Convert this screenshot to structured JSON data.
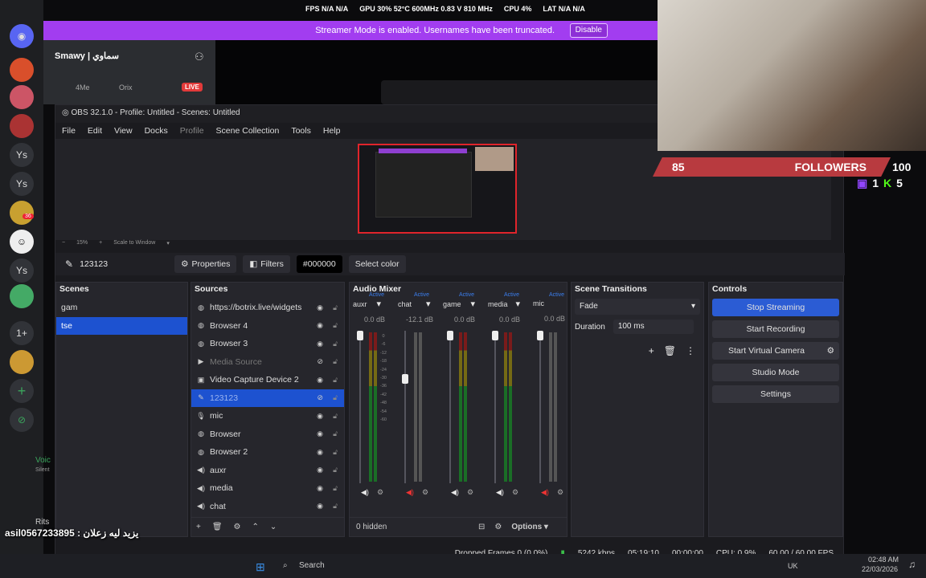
{
  "stats_overlay": {
    "fps_label": "FPS",
    "fps_value": "N/A N/A",
    "gpu": "GPU 30% 52°C 600MHz 0.83 V 810 MHz",
    "cpu": "CPU 4%",
    "lat": "LAT N/A N/A"
  },
  "banner": {
    "text": "Streamer Mode is enabled. Usernames have been truncated.",
    "button": "Disable"
  },
  "discord": {
    "server_title": "Smawy | سماوي",
    "voice_user": "4Me",
    "voice_tag": "Orix",
    "live_badge": "LIVE",
    "rail_items": [
      "Ys",
      "Ys",
      "Ys",
      "1+"
    ],
    "badge_36": "36",
    "voice_label": "Voic",
    "voice_sub": "Silent",
    "bottom_user": "Rits"
  },
  "obs": {
    "title": "OBS 32.1.0 - Profile: Untitled - Scenes: Untitled",
    "menu": [
      "File",
      "Edit",
      "View",
      "Docks",
      "Profile",
      "Scene Collection",
      "Tools",
      "Help"
    ],
    "zoom": {
      "pct": "15%",
      "scale": "Scale to Window"
    },
    "toolbar": {
      "source_name": "123123",
      "properties": "Properties",
      "filters": "Filters",
      "color_hex": "#000000",
      "select_color": "Select color"
    },
    "scenes": {
      "title": "Scenes",
      "items": [
        "gam",
        "tse"
      ]
    },
    "sources": {
      "title": "Sources",
      "items": [
        {
          "name": "https://botrix.live/widgets"
        },
        {
          "name": "Browser 4"
        },
        {
          "name": "Browser 3"
        },
        {
          "name": "Media Source"
        },
        {
          "name": "Video Capture Device 2"
        },
        {
          "name": "123123"
        },
        {
          "name": "mic"
        },
        {
          "name": "Browser"
        },
        {
          "name": "Browser 2"
        },
        {
          "name": "auxr"
        },
        {
          "name": "media"
        },
        {
          "name": "chat"
        }
      ],
      "hidden_count": "0 hidden"
    },
    "mixer": {
      "title": "Audio Mixer",
      "active_label": "Active",
      "channels": [
        {
          "name": "auxr",
          "db": "0.0 dB"
        },
        {
          "name": "chat",
          "db": "-12.1 dB"
        },
        {
          "name": "game",
          "db": "0.0 dB"
        },
        {
          "name": "media",
          "db": "0.0 dB"
        },
        {
          "name": "mic",
          "db": "0.0 dB"
        }
      ],
      "scale": [
        "0",
        "-6",
        "-12",
        "-18",
        "-24",
        "-30",
        "-36",
        "-42",
        "-48",
        "-54",
        "-60"
      ],
      "options": "Options"
    },
    "transitions": {
      "title": "Scene Transitions",
      "type": "Fade",
      "duration_label": "Duration",
      "duration_value": "100 ms"
    },
    "controls": {
      "title": "Controls",
      "stop_streaming": "Stop Streaming",
      "start_recording": "Start Recording",
      "start_virtual_camera": "Start Virtual Camera",
      "studio_mode": "Studio Mode",
      "settings": "Settings"
    },
    "status": {
      "dropped": "Dropped Frames 0 (0.0%)",
      "bitrate": "5242 kbps",
      "stream_time": "05:19:10",
      "rec_time": "00:00:00",
      "cpu": "CPU: 0.9%",
      "fps": "60.00 / 60.00 FPS"
    }
  },
  "overlay": {
    "followers_label": "FOLLOWERS",
    "followers_start": "85",
    "followers_goal": "100",
    "twitch_count": "1",
    "kick_count": "5"
  },
  "chat_line": "asil0567233895 : يزيد ليه زعلان",
  "taskbar": {
    "search": "Search",
    "lang": "UK",
    "time": "02:48 AM",
    "date": "22/03/2026"
  },
  "colors": {
    "accent": "#2b5cd4",
    "banner": "#a23df0",
    "follow_bar": "#b83a3f",
    "preview_border": "#e0242b"
  }
}
